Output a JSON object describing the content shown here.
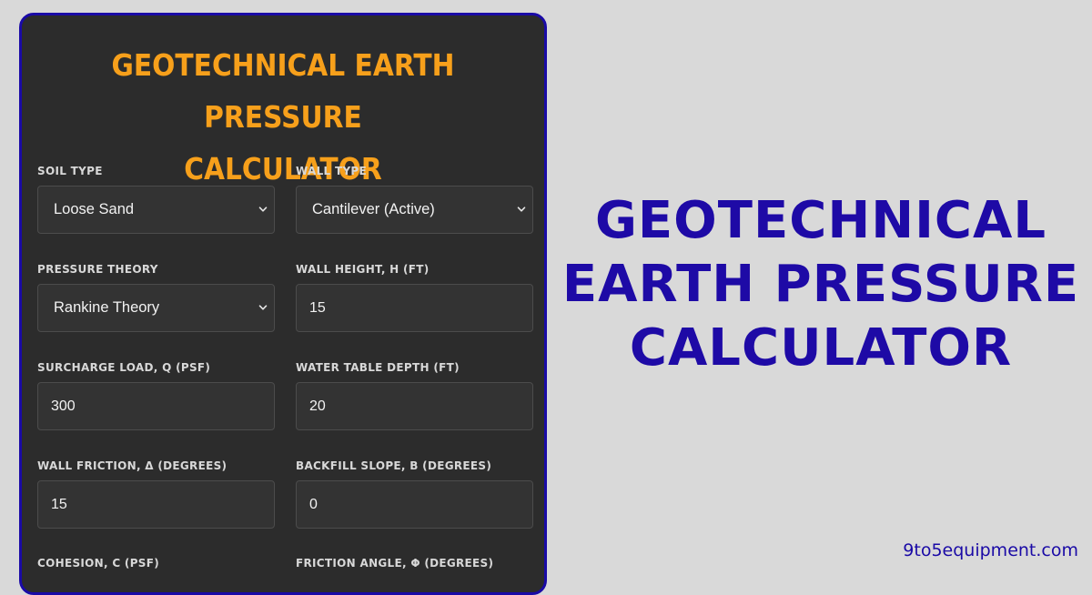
{
  "card": {
    "title_line1": "GEOTECHNICAL EARTH PRESSURE",
    "title_line2": "CALCULATOR"
  },
  "fields": {
    "soil_type": {
      "label": "SOIL TYPE",
      "value": "Loose Sand"
    },
    "wall_type": {
      "label": "WALL TYPE",
      "value": "Cantilever (Active)"
    },
    "pressure_theory": {
      "label": "PRESSURE THEORY",
      "value": "Rankine Theory"
    },
    "wall_height": {
      "label": "WALL HEIGHT, H (FT)",
      "value": "15"
    },
    "surcharge_load": {
      "label": "SURCHARGE LOAD, Q (PSF)",
      "value": "300"
    },
    "water_table_depth": {
      "label": "WATER TABLE DEPTH (FT)",
      "value": "20"
    },
    "wall_friction": {
      "label": "WALL FRICTION, Δ (DEGREES)",
      "value": "15"
    },
    "backfill_slope": {
      "label": "BACKFILL SLOPE, Β (DEGREES)",
      "value": "0"
    },
    "cohesion": {
      "label": "COHESION, C (PSF)"
    },
    "friction_angle": {
      "label": "FRICTION ANGLE, Φ (DEGREES)"
    }
  },
  "hero": {
    "line1": "GEOTECHNICAL",
    "line2": "EARTH PRESSURE",
    "line3": "CALCULATOR"
  },
  "brand": "9to5equipment.com",
  "colors": {
    "page_background": "#d9d9d9",
    "card_background": "#2c2c2c",
    "card_border": "#1a0aa6",
    "title_accent": "#f7a01b",
    "hero_text": "#1e0aa6"
  },
  "icons": {
    "select_indicator": "chevron-down-icon"
  }
}
